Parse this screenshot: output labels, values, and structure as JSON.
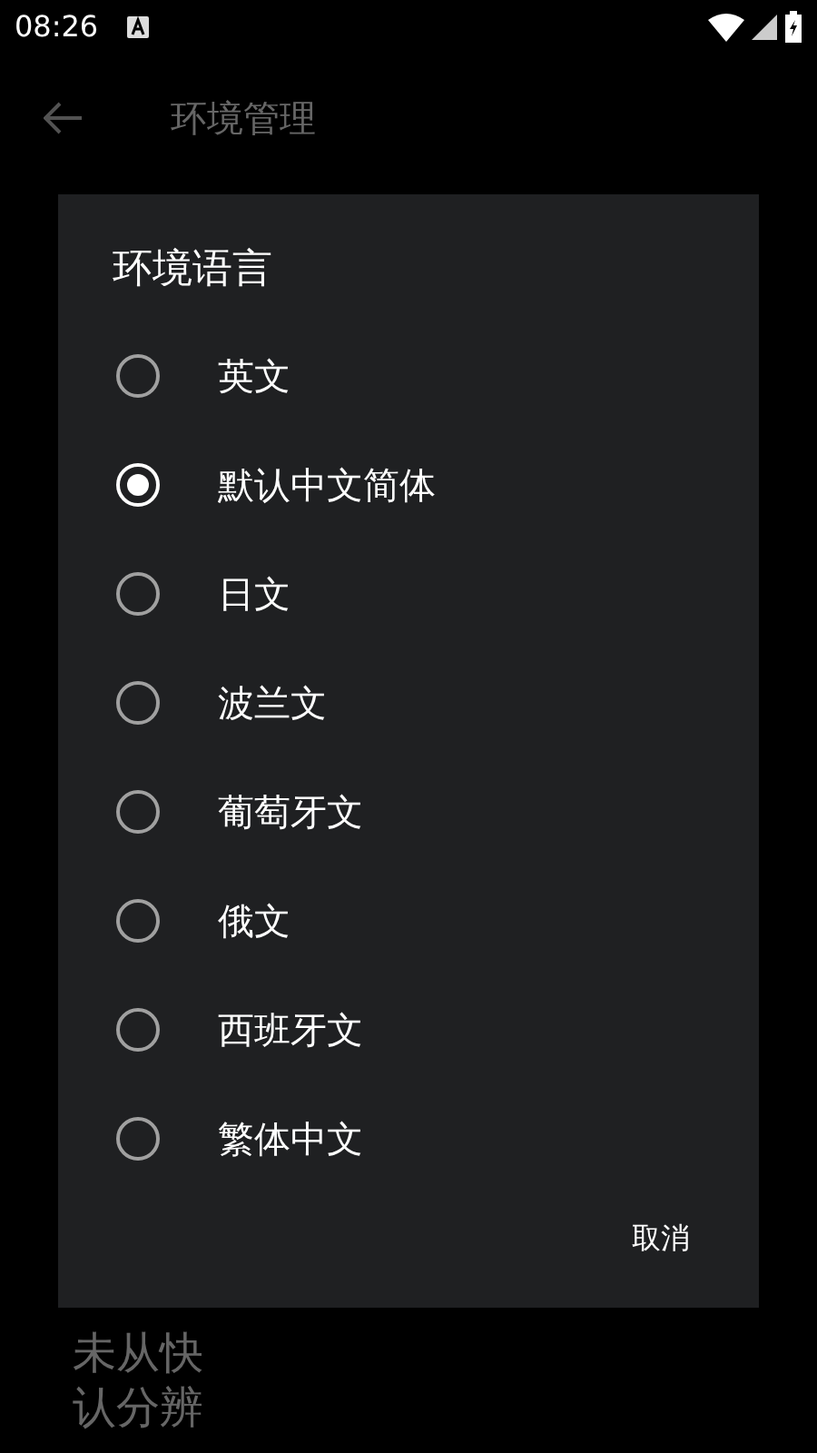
{
  "status_bar": {
    "time": "08:26"
  },
  "app_bar": {
    "title": "环境管理"
  },
  "background_rows": [
    "未从快",
    "认分辨"
  ],
  "dialog": {
    "title": "环境语言",
    "options": [
      {
        "label": "英文",
        "selected": false
      },
      {
        "label": "默认中文简体",
        "selected": true
      },
      {
        "label": "日文",
        "selected": false
      },
      {
        "label": "波兰文",
        "selected": false
      },
      {
        "label": "葡萄牙文",
        "selected": false
      },
      {
        "label": "俄文",
        "selected": false
      },
      {
        "label": "西班牙文",
        "selected": false
      },
      {
        "label": "繁体中文",
        "selected": false
      }
    ],
    "cancel": "取消"
  }
}
